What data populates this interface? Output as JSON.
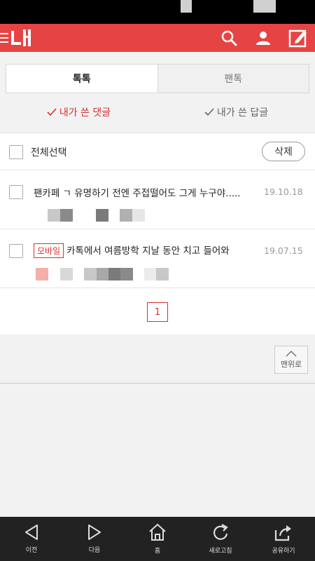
{
  "header": {
    "menu_icon": "hamburger-icon",
    "brand_icon": "logo-mark",
    "actions": [
      {
        "icon": "search-icon"
      },
      {
        "icon": "user-icon"
      },
      {
        "icon": "write-icon"
      }
    ],
    "brand_color": "#e64444"
  },
  "tabs": [
    {
      "label": "톡톡",
      "active": true
    },
    {
      "label": "팬톡",
      "active": false
    }
  ],
  "subtabs": [
    {
      "label": "내가 쓴 댓글",
      "active": true,
      "icon": "check-icon"
    },
    {
      "label": "내가 쓴 답글",
      "active": false,
      "icon": "check-icon"
    }
  ],
  "select_row": {
    "label": "전체선택",
    "delete_label": "삭제"
  },
  "posts": [
    {
      "title": "팬카페 ㄱ 유명하기 전엔 주접떨어도 그게 누구야.....",
      "date": "19.10.18",
      "badge": ""
    },
    {
      "title": "카톡에서 여름방학 지날 동안 치고 들어와",
      "date": "19.07.15",
      "badge": "모바일"
    }
  ],
  "pagination": {
    "current": "1"
  },
  "scroll_top": {
    "label": "맨위로",
    "icon": "chevron-up-icon"
  },
  "bottom_nav": [
    {
      "label": "이전",
      "icon": "back-icon"
    },
    {
      "label": "다음",
      "icon": "forward-icon"
    },
    {
      "label": "홈",
      "icon": "home-icon"
    },
    {
      "label": "새로고침",
      "icon": "refresh-icon"
    },
    {
      "label": "공유하기",
      "icon": "share-icon"
    }
  ],
  "colors": {
    "accent": "#d93030",
    "nav_bg": "#222222"
  }
}
